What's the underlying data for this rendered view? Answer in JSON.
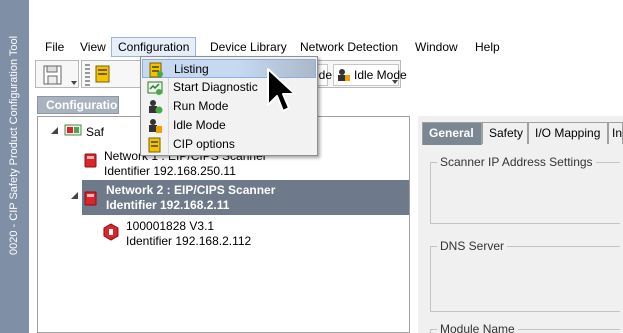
{
  "window": {
    "vertical_title": "0020 - CIP Safety Product Configuration Tool"
  },
  "menubar": {
    "items": [
      {
        "label": "File"
      },
      {
        "label": "View"
      },
      {
        "label": "Configuration"
      },
      {
        "label": "Device Library"
      },
      {
        "label": "Network Detection"
      },
      {
        "label": "Window"
      },
      {
        "label": "Help"
      }
    ]
  },
  "toolbar": {
    "run_mode_label_partial": "ode",
    "idle_mode_label": "Idle Mode"
  },
  "config_menu": {
    "items": [
      {
        "label": "Listing",
        "icon": "listing-icon"
      },
      {
        "label": "Start Diagnostic",
        "icon": "diagnostic-icon"
      },
      {
        "label": "Run Mode",
        "icon": "run-mode-icon"
      },
      {
        "label": "Idle Mode",
        "icon": "idle-mode-icon"
      },
      {
        "label": "CIP options",
        "icon": "cip-options-icon"
      }
    ],
    "hovered": "Listing"
  },
  "left_panel": {
    "tab_label": "Configuratio"
  },
  "tree": {
    "root_label": "Safety",
    "network1": {
      "label_partial": "Network 1 : EIP/CIPS Scanner",
      "identifier": "Identifier 192.168.250.11"
    },
    "network2": {
      "label": "Network 2 : EIP/CIPS Scanner",
      "identifier": "Identifier 192.168.2.11"
    },
    "device": {
      "label": "100001828 V3.1",
      "identifier": "Identifier 192.168.2.112"
    }
  },
  "details": {
    "tabs": [
      {
        "label": "General"
      },
      {
        "label": "Safety"
      },
      {
        "label": "I/O Mapping"
      },
      {
        "label": "In"
      }
    ],
    "groups": {
      "scanner_ip": "Scanner IP Address Settings",
      "dns_server": "DNS Server",
      "module_name": "Module Name"
    }
  },
  "colors": {
    "selection": "#6e7a89",
    "title_band": "#7f8fa6",
    "active_tab": "#7c8794",
    "menu_hover": "#c6d9f1"
  }
}
